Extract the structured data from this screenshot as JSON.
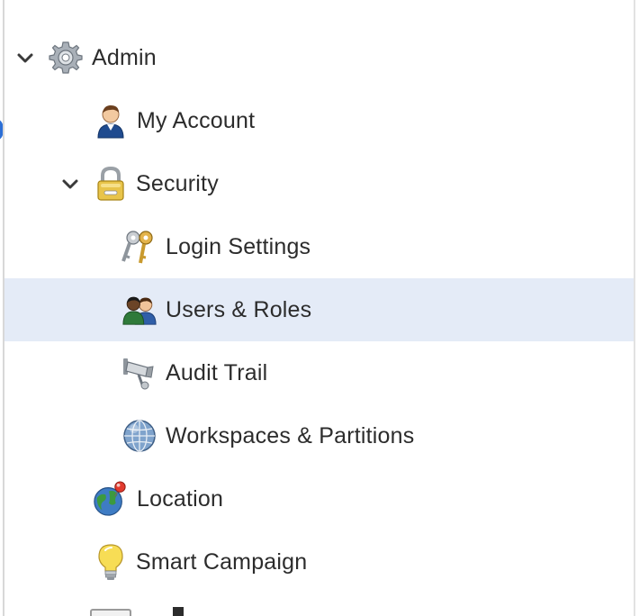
{
  "tree": {
    "items": [
      {
        "label": "Admin",
        "icon": "gear-icon",
        "expanded": true
      },
      {
        "label": "My Account",
        "icon": "user-icon"
      },
      {
        "label": "Security",
        "icon": "lock-icon",
        "expanded": true
      },
      {
        "label": "Login Settings",
        "icon": "keys-icon"
      },
      {
        "label": "Users & Roles",
        "icon": "users-icon",
        "selected": true
      },
      {
        "label": "Audit Trail",
        "icon": "camera-icon"
      },
      {
        "label": "Workspaces & Partitions",
        "icon": "globe-grid-icon"
      },
      {
        "label": "Location",
        "icon": "globe-pin-icon"
      },
      {
        "label": "Smart Campaign",
        "icon": "lightbulb-icon"
      }
    ]
  },
  "colors": {
    "selected_row": "#e4ebf7",
    "text": "#2c2c2c",
    "chevron": "#3a3a3a",
    "edge_indicator": "#2c6fd6"
  }
}
